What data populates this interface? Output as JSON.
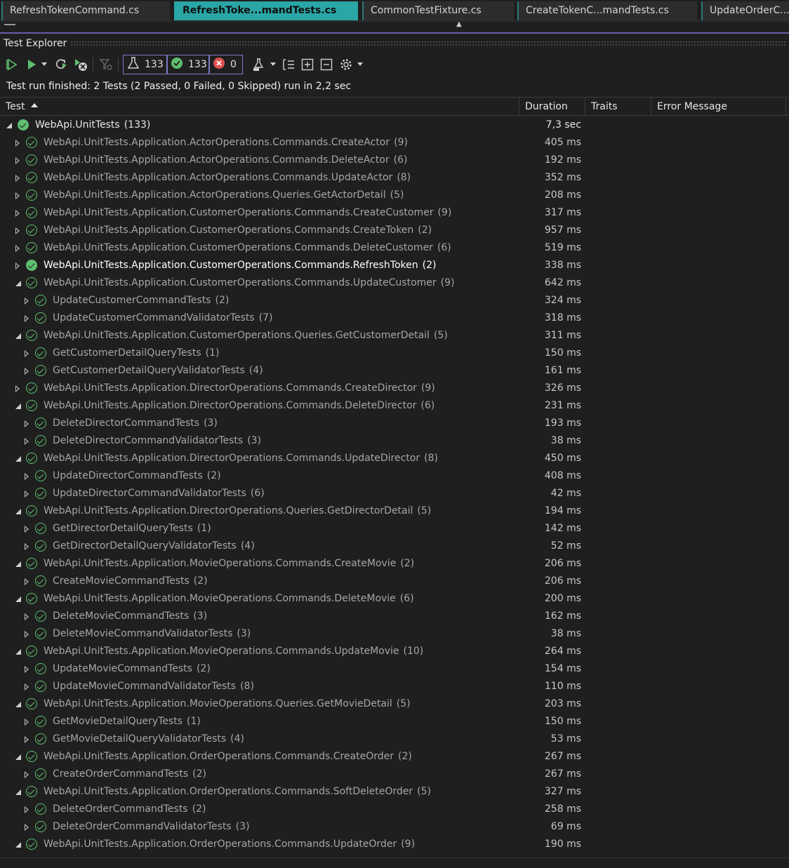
{
  "tabs": [
    {
      "label": "RefreshTokenCommand.cs",
      "active": false
    },
    {
      "label": "RefreshToke...mandTests.cs",
      "active": true
    },
    {
      "label": "CommonTestFixture.cs",
      "active": false
    },
    {
      "label": "CreateTokenC...mandTests.cs",
      "active": false
    },
    {
      "label": "UpdateOrderC...d",
      "active": false
    }
  ],
  "panel": {
    "title": "Test Explorer"
  },
  "toolbar": {
    "total_count": "133",
    "passed_count": "133",
    "failed_count": "0",
    "icons": [
      "run-all-icon",
      "run-icon",
      "dropdown-icon",
      "repeat-last-run-icon",
      "cancel-run-icon",
      "filter-icon",
      "flask-icon",
      "pass-icon",
      "fail-icon",
      "playlist-icon",
      "group-by-icon",
      "expand-all-icon",
      "collapse-all-icon",
      "settings-icon"
    ]
  },
  "status": {
    "text": "Test run finished: 2 Tests (2 Passed, 0 Failed, 0 Skipped) run in 2,2 sec"
  },
  "columns": {
    "test": "Test",
    "duration": "Duration",
    "traits": "Traits",
    "error": "Error Message"
  },
  "colors": {
    "pass": "#5fbf6f",
    "fail": "#e05252",
    "active_tab": "#2aa6a6",
    "accent_line": "#6e5aa8"
  },
  "rows": [
    {
      "level": 0,
      "state": "expanded",
      "name": "WebApi.UnitTests",
      "count": "(133)",
      "duration": "7,3 sec"
    },
    {
      "level": 1,
      "state": "collapsed",
      "name": "WebApi.UnitTests.Application.ActorOperations.Commands.CreateActor",
      "count": "(9)",
      "duration": "405 ms"
    },
    {
      "level": 1,
      "state": "collapsed",
      "name": "WebApi.UnitTests.Application.ActorOperations.Commands.DeleteActor",
      "count": "(6)",
      "duration": "192 ms"
    },
    {
      "level": 1,
      "state": "collapsed",
      "name": "WebApi.UnitTests.Application.ActorOperations.Commands.UpdateActor",
      "count": "(8)",
      "duration": "352 ms"
    },
    {
      "level": 1,
      "state": "collapsed",
      "name": "WebApi.UnitTests.Application.ActorOperations.Queries.GetActorDetail",
      "count": "(5)",
      "duration": "208 ms"
    },
    {
      "level": 1,
      "state": "collapsed",
      "name": "WebApi.UnitTests.Application.CustomerOperations.Commands.CreateCustomer",
      "count": "(9)",
      "duration": "317 ms"
    },
    {
      "level": 1,
      "state": "collapsed",
      "name": "WebApi.UnitTests.Application.CustomerOperations.Commands.CreateToken",
      "count": "(2)",
      "duration": "957 ms"
    },
    {
      "level": 1,
      "state": "collapsed",
      "name": "WebApi.UnitTests.Application.CustomerOperations.Commands.DeleteCustomer",
      "count": "(6)",
      "duration": "519 ms"
    },
    {
      "level": 1,
      "state": "collapsed",
      "name": "WebApi.UnitTests.Application.CustomerOperations.Commands.RefreshToken",
      "count": "(2)",
      "duration": "338 ms",
      "highlight": true
    },
    {
      "level": 1,
      "state": "expanded",
      "name": "WebApi.UnitTests.Application.CustomerOperations.Commands.UpdateCustomer",
      "count": "(9)",
      "duration": "642 ms"
    },
    {
      "level": 2,
      "state": "collapsed",
      "name": "UpdateCustomerCommandTests",
      "count": "(2)",
      "duration": "324 ms"
    },
    {
      "level": 2,
      "state": "collapsed",
      "name": "UpdateCustomerCommandValidatorTests",
      "count": "(7)",
      "duration": "318 ms"
    },
    {
      "level": 1,
      "state": "expanded",
      "name": "WebApi.UnitTests.Application.CustomerOperations.Queries.GetCustomerDetail",
      "count": "(5)",
      "duration": "311 ms"
    },
    {
      "level": 2,
      "state": "collapsed",
      "name": "GetCustomerDetailQueryTests",
      "count": "(1)",
      "duration": "150 ms"
    },
    {
      "level": 2,
      "state": "collapsed",
      "name": "GetCustomerDetailQueryValidatorTests",
      "count": "(4)",
      "duration": "161 ms"
    },
    {
      "level": 1,
      "state": "collapsed",
      "name": "WebApi.UnitTests.Application.DirectorOperations.Commands.CreateDirector",
      "count": "(9)",
      "duration": "326 ms"
    },
    {
      "level": 1,
      "state": "expanded",
      "name": "WebApi.UnitTests.Application.DirectorOperations.Commands.DeleteDirector",
      "count": "(6)",
      "duration": "231 ms"
    },
    {
      "level": 2,
      "state": "collapsed",
      "name": "DeleteDirectorCommandTests",
      "count": "(3)",
      "duration": "193 ms"
    },
    {
      "level": 2,
      "state": "collapsed",
      "name": "DeleteDirectorCommandValidatorTests",
      "count": "(3)",
      "duration": "38 ms"
    },
    {
      "level": 1,
      "state": "expanded",
      "name": "WebApi.UnitTests.Application.DirectorOperations.Commands.UpdateDirector",
      "count": "(8)",
      "duration": "450 ms"
    },
    {
      "level": 2,
      "state": "collapsed",
      "name": "UpdateDirectorCommandTests",
      "count": "(2)",
      "duration": "408 ms"
    },
    {
      "level": 2,
      "state": "collapsed",
      "name": "UpdateDirectorCommandValidatorTests",
      "count": "(6)",
      "duration": "42 ms"
    },
    {
      "level": 1,
      "state": "expanded",
      "name": "WebApi.UnitTests.Application.DirectorOperations.Queries.GetDirectorDetail",
      "count": "(5)",
      "duration": "194 ms"
    },
    {
      "level": 2,
      "state": "collapsed",
      "name": "GetDirectorDetailQueryTests",
      "count": "(1)",
      "duration": "142 ms"
    },
    {
      "level": 2,
      "state": "collapsed",
      "name": "GetDirectorDetailQueryValidatorTests",
      "count": "(4)",
      "duration": "52 ms"
    },
    {
      "level": 1,
      "state": "expanded",
      "name": "WebApi.UnitTests.Application.MovieOperations.Commands.CreateMovie",
      "count": "(2)",
      "duration": "206 ms"
    },
    {
      "level": 2,
      "state": "collapsed",
      "name": "CreateMovieCommandTests",
      "count": "(2)",
      "duration": "206 ms"
    },
    {
      "level": 1,
      "state": "expanded",
      "name": "WebApi.UnitTests.Application.MovieOperations.Commands.DeleteMovie",
      "count": "(6)",
      "duration": "200 ms"
    },
    {
      "level": 2,
      "state": "collapsed",
      "name": "DeleteMovieCommandTests",
      "count": "(3)",
      "duration": "162 ms"
    },
    {
      "level": 2,
      "state": "collapsed",
      "name": "DeleteMovieCommandValidatorTests",
      "count": "(3)",
      "duration": "38 ms"
    },
    {
      "level": 1,
      "state": "expanded",
      "name": "WebApi.UnitTests.Application.MovieOperations.Commands.UpdateMovie",
      "count": "(10)",
      "duration": "264 ms"
    },
    {
      "level": 2,
      "state": "collapsed",
      "name": "UpdateMovieCommandTests",
      "count": "(2)",
      "duration": "154 ms"
    },
    {
      "level": 2,
      "state": "collapsed",
      "name": "UpdateMovieCommandValidatorTests",
      "count": "(8)",
      "duration": "110 ms"
    },
    {
      "level": 1,
      "state": "expanded",
      "name": "WebApi.UnitTests.Application.MovieOperations.Queries.GetMovieDetail",
      "count": "(5)",
      "duration": "203 ms"
    },
    {
      "level": 2,
      "state": "collapsed",
      "name": "GetMovieDetailQueryTests",
      "count": "(1)",
      "duration": "150 ms"
    },
    {
      "level": 2,
      "state": "collapsed",
      "name": "GetMovieDetailQueryValidatorTests",
      "count": "(4)",
      "duration": "53 ms"
    },
    {
      "level": 1,
      "state": "expanded",
      "name": "WebApi.UnitTests.Application.OrderOperations.Commands.CreateOrder",
      "count": "(2)",
      "duration": "267 ms"
    },
    {
      "level": 2,
      "state": "collapsed",
      "name": "CreateOrderCommandTests",
      "count": "(2)",
      "duration": "267 ms"
    },
    {
      "level": 1,
      "state": "expanded",
      "name": "WebApi.UnitTests.Application.OrderOperations.Commands.SoftDeleteOrder",
      "count": "(5)",
      "duration": "327 ms"
    },
    {
      "level": 2,
      "state": "collapsed",
      "name": "DeleteOrderCommandTests",
      "count": "(2)",
      "duration": "258 ms"
    },
    {
      "level": 2,
      "state": "collapsed",
      "name": "DeleteOrderCommandValidatorTests",
      "count": "(3)",
      "duration": "69 ms"
    },
    {
      "level": 1,
      "state": "expanded",
      "name": "WebApi.UnitTests.Application.OrderOperations.Commands.UpdateOrder",
      "count": "(9)",
      "duration": "190 ms"
    }
  ]
}
